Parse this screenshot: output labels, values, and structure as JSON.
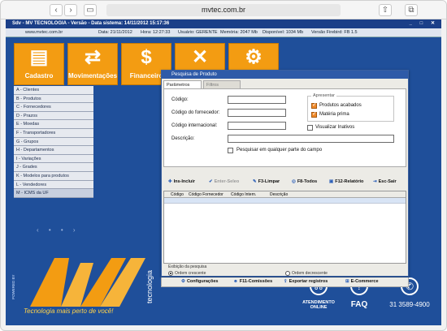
{
  "browser": {
    "url": "mvtec.com.br"
  },
  "window": {
    "title": "Sdv - MV TECNOLOGIA - Versão  - Data sistema: 14/11/2012 15:17:36",
    "status": {
      "site": "www.mvtec.com.br",
      "date": "Data: 21/11/2012",
      "time": "Hora: 12:27:33",
      "user": "Usuário: GERENTE",
      "memory": "Memória: 2047 Mb",
      "available": "Disponível: 1034 Mb",
      "version": "Versão Firebird: FB 1.5"
    }
  },
  "big_buttons": [
    {
      "label": "Cadastro",
      "icon": "register-device-icon"
    },
    {
      "label": "Movimentações",
      "icon": "arrows-icon"
    },
    {
      "label": "Financeiro",
      "icon": "dollar-icon"
    },
    {
      "label": "",
      "icon": "tools-icon"
    },
    {
      "label": "",
      "icon": "gears-icon"
    }
  ],
  "menu": [
    "A - Clientes",
    "B - Produtos",
    "C - Fornecedores",
    "D - Prazos",
    "E - Moedas",
    "F - Transportadores",
    "G - Grupos",
    "H - Departamentos",
    "I - Variações",
    "J - Grades",
    "K - Modelos para produtos",
    "L - Vendedores",
    "M - ICMS da UF"
  ],
  "pager": "‹ • • ›",
  "branding": {
    "tagline": "Tecnologia mais perto de você!",
    "powered": "POWERED BY",
    "side_text": "tecnologia"
  },
  "contact": {
    "atendimento": "ATENDIMENTO",
    "online": "ONLINE",
    "faq": "FAQ",
    "phone": "31 3589-4900"
  },
  "dialog": {
    "title": "Pesquisa de Produto",
    "tabs": [
      "Parâmetros iniciais",
      "Filtros adicionais"
    ],
    "fields": {
      "codigo": "Código:",
      "codigo_fornecedor": "Código do fornecedor:",
      "codigo_internacional": "Código internacional:",
      "descricao": "Descrição:"
    },
    "apresentar": {
      "title": "Apresentar",
      "produtos_acabados": "Produtos acabados",
      "materia_prima": "Matéria prima",
      "visualizar_inativos": "Visualizar Inativos"
    },
    "pesquisar_label": "Pesquisar em qualquer parte do campo",
    "toolbar": [
      "Ins-Incluir",
      "Enter-Seleo",
      "F3-Limpar",
      "F8-Todos",
      "F12-Relatório",
      "Esc-Sair"
    ],
    "columns": [
      "Código",
      "Código Fornecedor",
      "Código Intern.",
      "Descrição"
    ],
    "order": {
      "title": "Exibição da pesquisa",
      "asc": "Ordem crescente",
      "desc": "Ordem decrescente"
    },
    "footer": [
      "Configurações",
      "F11-Comissões",
      "Exportar registros",
      "E-Commerce"
    ]
  }
}
